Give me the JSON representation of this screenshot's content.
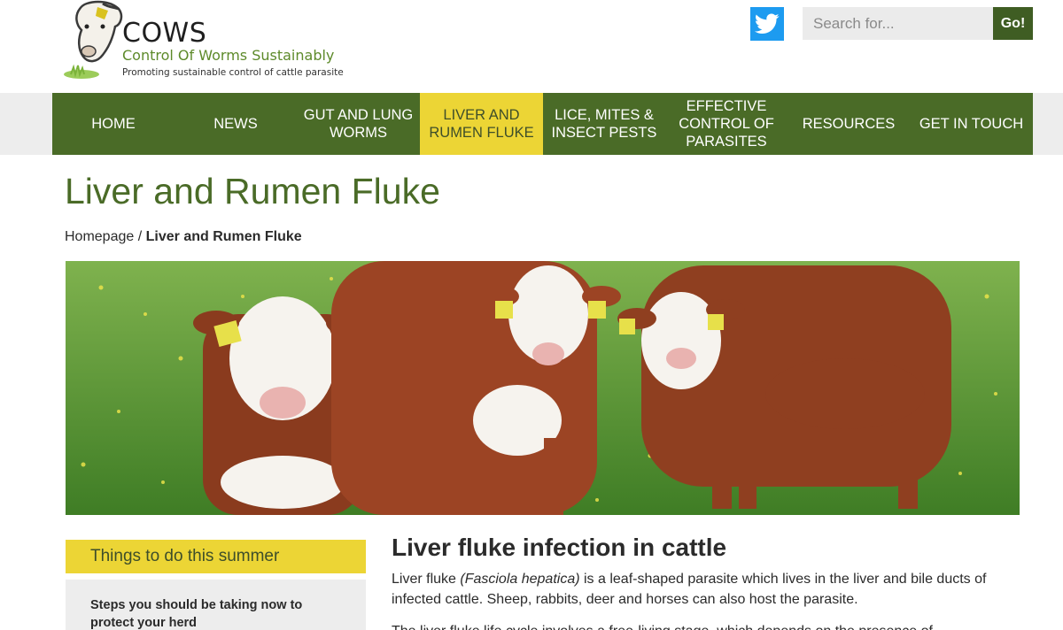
{
  "brand": {
    "title": "COWS",
    "subtitle": "Control Of Worms Sustainably",
    "tagline": "Promoting sustainable control of cattle parasite"
  },
  "header": {
    "twitter_icon": "twitter-bird-icon",
    "search_placeholder": "Search for...",
    "search_value": "",
    "search_button": "Go!"
  },
  "nav": {
    "items": [
      {
        "label": "HOME",
        "active": false
      },
      {
        "label": "NEWS",
        "active": false
      },
      {
        "label": "GUT AND LUNG WORMS",
        "active": false
      },
      {
        "label": "LIVER AND RUMEN FLUKE",
        "active": true
      },
      {
        "label": "LICE, MITES & INSECT PESTS",
        "active": false
      },
      {
        "label": "EFFECTIVE CONTROL OF PARASITES",
        "active": false
      },
      {
        "label": "RESOURCES",
        "active": false
      },
      {
        "label": "GET IN TOUCH",
        "active": false
      }
    ]
  },
  "page": {
    "title": "Liver and Rumen Fluke",
    "breadcrumb_home": "Homepage",
    "breadcrumb_sep": " / ",
    "breadcrumb_current": "Liver and Rumen Fluke"
  },
  "sidebar": {
    "heading": "Things to do this summer",
    "body": "Steps you should be taking now to protect your herd"
  },
  "content": {
    "heading": "Liver fluke infection in cattle",
    "p1_start": "Liver fluke ",
    "p1_italic": "(Fasciola hepatica)",
    "p1_rest": " is a leaf-shaped parasite which lives in the liver and bile ducts of infected cattle. Sheep, rabbits, deer and horses can also host the parasite.",
    "p2": "The liver fluke life cycle involves a free-living stage, which depends on the presence of"
  },
  "colors": {
    "brand_green": "#4a6b27",
    "accent_yellow": "#ecd535",
    "twitter_blue": "#1d9bf0",
    "search_button": "#3f5d23"
  }
}
